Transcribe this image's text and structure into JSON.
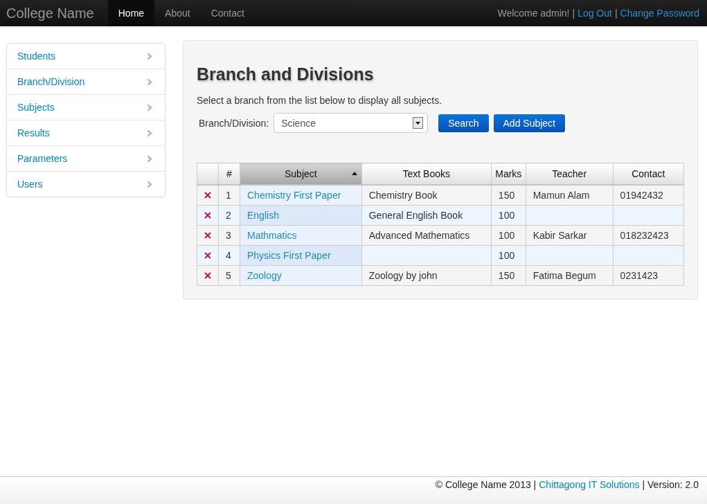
{
  "navbar": {
    "brand": "College Name",
    "tabs": [
      {
        "label": "Home",
        "selected": true
      },
      {
        "label": "About",
        "selected": false
      },
      {
        "label": "Contact",
        "selected": false
      }
    ],
    "welcome": "Welcome admin!",
    "separator_1": "|",
    "logout": "Log Out",
    "separator_2": "|",
    "change_password": "Change Password"
  },
  "sidebar": {
    "items": [
      "Students",
      "Branch/Division",
      "Subjects",
      "Results",
      "Parameters",
      "Users"
    ]
  },
  "main": {
    "title": "Branch and Divisions",
    "hint": "Select a branch from the list below to display all subjects.",
    "branch_label": "Branch/Division:",
    "branch_value": "Science",
    "buttons": [
      "Search",
      "Add Subject"
    ]
  },
  "table": {
    "columns": [
      {
        "sorted": false
      },
      {
        "label": "#",
        "sorted": false
      },
      {
        "label": "Subject",
        "sorted": true
      },
      {
        "label": "Text Books",
        "sorted": false
      },
      {
        "label": "Marks",
        "sorted": false
      },
      {
        "label": "Teacher",
        "sorted": false
      },
      {
        "label": "Contact",
        "sorted": false
      }
    ],
    "rows": [
      {
        "no": "1",
        "subject": "Chemistry First Paper",
        "book": "Chemistry Book",
        "marks": "150",
        "teacher": "Mamun Alam",
        "contact": "01942432"
      },
      {
        "no": "2",
        "subject": "English",
        "book": "General English Book",
        "marks": "100"
      },
      {
        "no": "3",
        "subject": "Mathmatics",
        "book": "Advanced Mathematics",
        "marks": "100",
        "teacher": "Kabir Sarkar",
        "contact": "018232423"
      },
      {
        "no": "4",
        "subject": "Physics First Paper",
        "marks": "100"
      },
      {
        "no": "5",
        "subject": "Zoology",
        "book": "Zoology by john",
        "marks": "150",
        "teacher": "Fatima Begum",
        "contact": "0231423"
      }
    ]
  },
  "footer": {
    "copyright": "© College Name 2013 |",
    "company": "Chittagong IT Solutions",
    "version": "| Version: 2.0"
  }
}
